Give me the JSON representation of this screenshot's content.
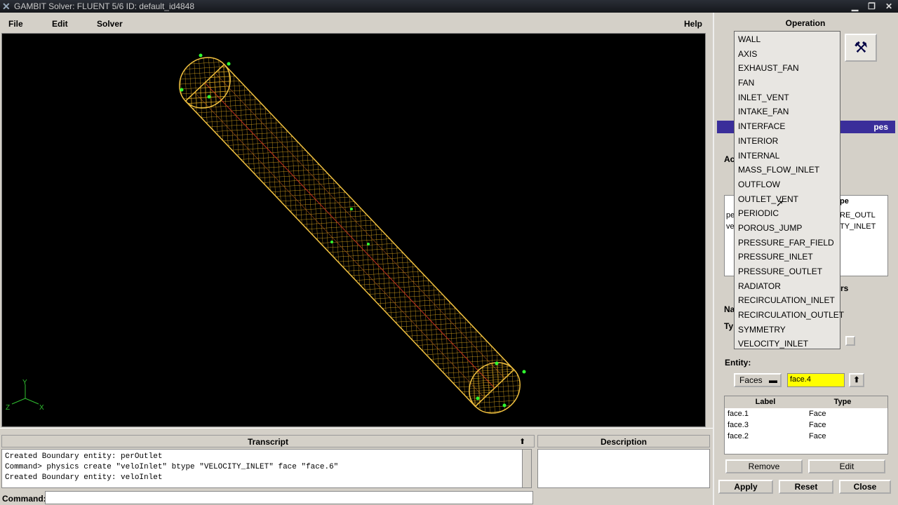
{
  "window": {
    "title": "GAMBIT    Solver: FLUENT 5/6    ID: default_id4848"
  },
  "menu": {
    "file": "File",
    "edit": "Edit",
    "solver": "Solver",
    "help": "Help"
  },
  "panels": {
    "operation": "Operation",
    "transcript": "Transcript",
    "description": "Description",
    "command_label": "Command:"
  },
  "transcript_lines": [
    "Created Boundary entity: perOutlet",
    "Command> physics create \"veloInlet\" btype \"VELOCITY_INLET\" face \"face.6\"",
    "Created Boundary entity: veloInlet"
  ],
  "boundary_panel": {
    "title_fragment": "pes",
    "top_list_header": "pe",
    "top_list_right": [
      "RE_OUTL",
      "TY_INLET"
    ],
    "top_list_left": [
      "pe",
      "ve"
    ],
    "side_labels": {
      "ac": "Ac",
      "na": "Na",
      "ty": "Ty",
      "rs": "rs"
    }
  },
  "type_dropdown": {
    "options": [
      "WALL",
      "AXIS",
      "EXHAUST_FAN",
      "FAN",
      "INLET_VENT",
      "INTAKE_FAN",
      "INTERFACE",
      "INTERIOR",
      "INTERNAL",
      "MASS_FLOW_INLET",
      "OUTFLOW",
      "OUTLET_VENT",
      "PERIODIC",
      "POROUS_JUMP",
      "PRESSURE_FAR_FIELD",
      "PRESSURE_INLET",
      "PRESSURE_OUTLET",
      "RADIATOR",
      "RECIRCULATION_INLET",
      "RECIRCULATION_OUTLET",
      "SYMMETRY",
      "VELOCITY_INLET"
    ]
  },
  "entity": {
    "label": "Entity:",
    "type_value": "Faces",
    "input_value": "face.4",
    "table_headers": {
      "label": "Label",
      "type": "Type"
    },
    "rows": [
      {
        "label": "face.1",
        "type": "Face"
      },
      {
        "label": "face.3",
        "type": "Face"
      },
      {
        "label": "face.2",
        "type": "Face"
      }
    ]
  },
  "buttons": {
    "remove": "Remove",
    "edit": "Edit",
    "apply": "Apply",
    "reset": "Reset",
    "close": "Close"
  },
  "axes": {
    "y": "Y",
    "z": "Z",
    "x": "X"
  },
  "colors": {
    "mesh": "#e8b020",
    "viewport_bg": "#000000",
    "highlight": "#ffff00",
    "title_blue": "#3a2e9a"
  }
}
